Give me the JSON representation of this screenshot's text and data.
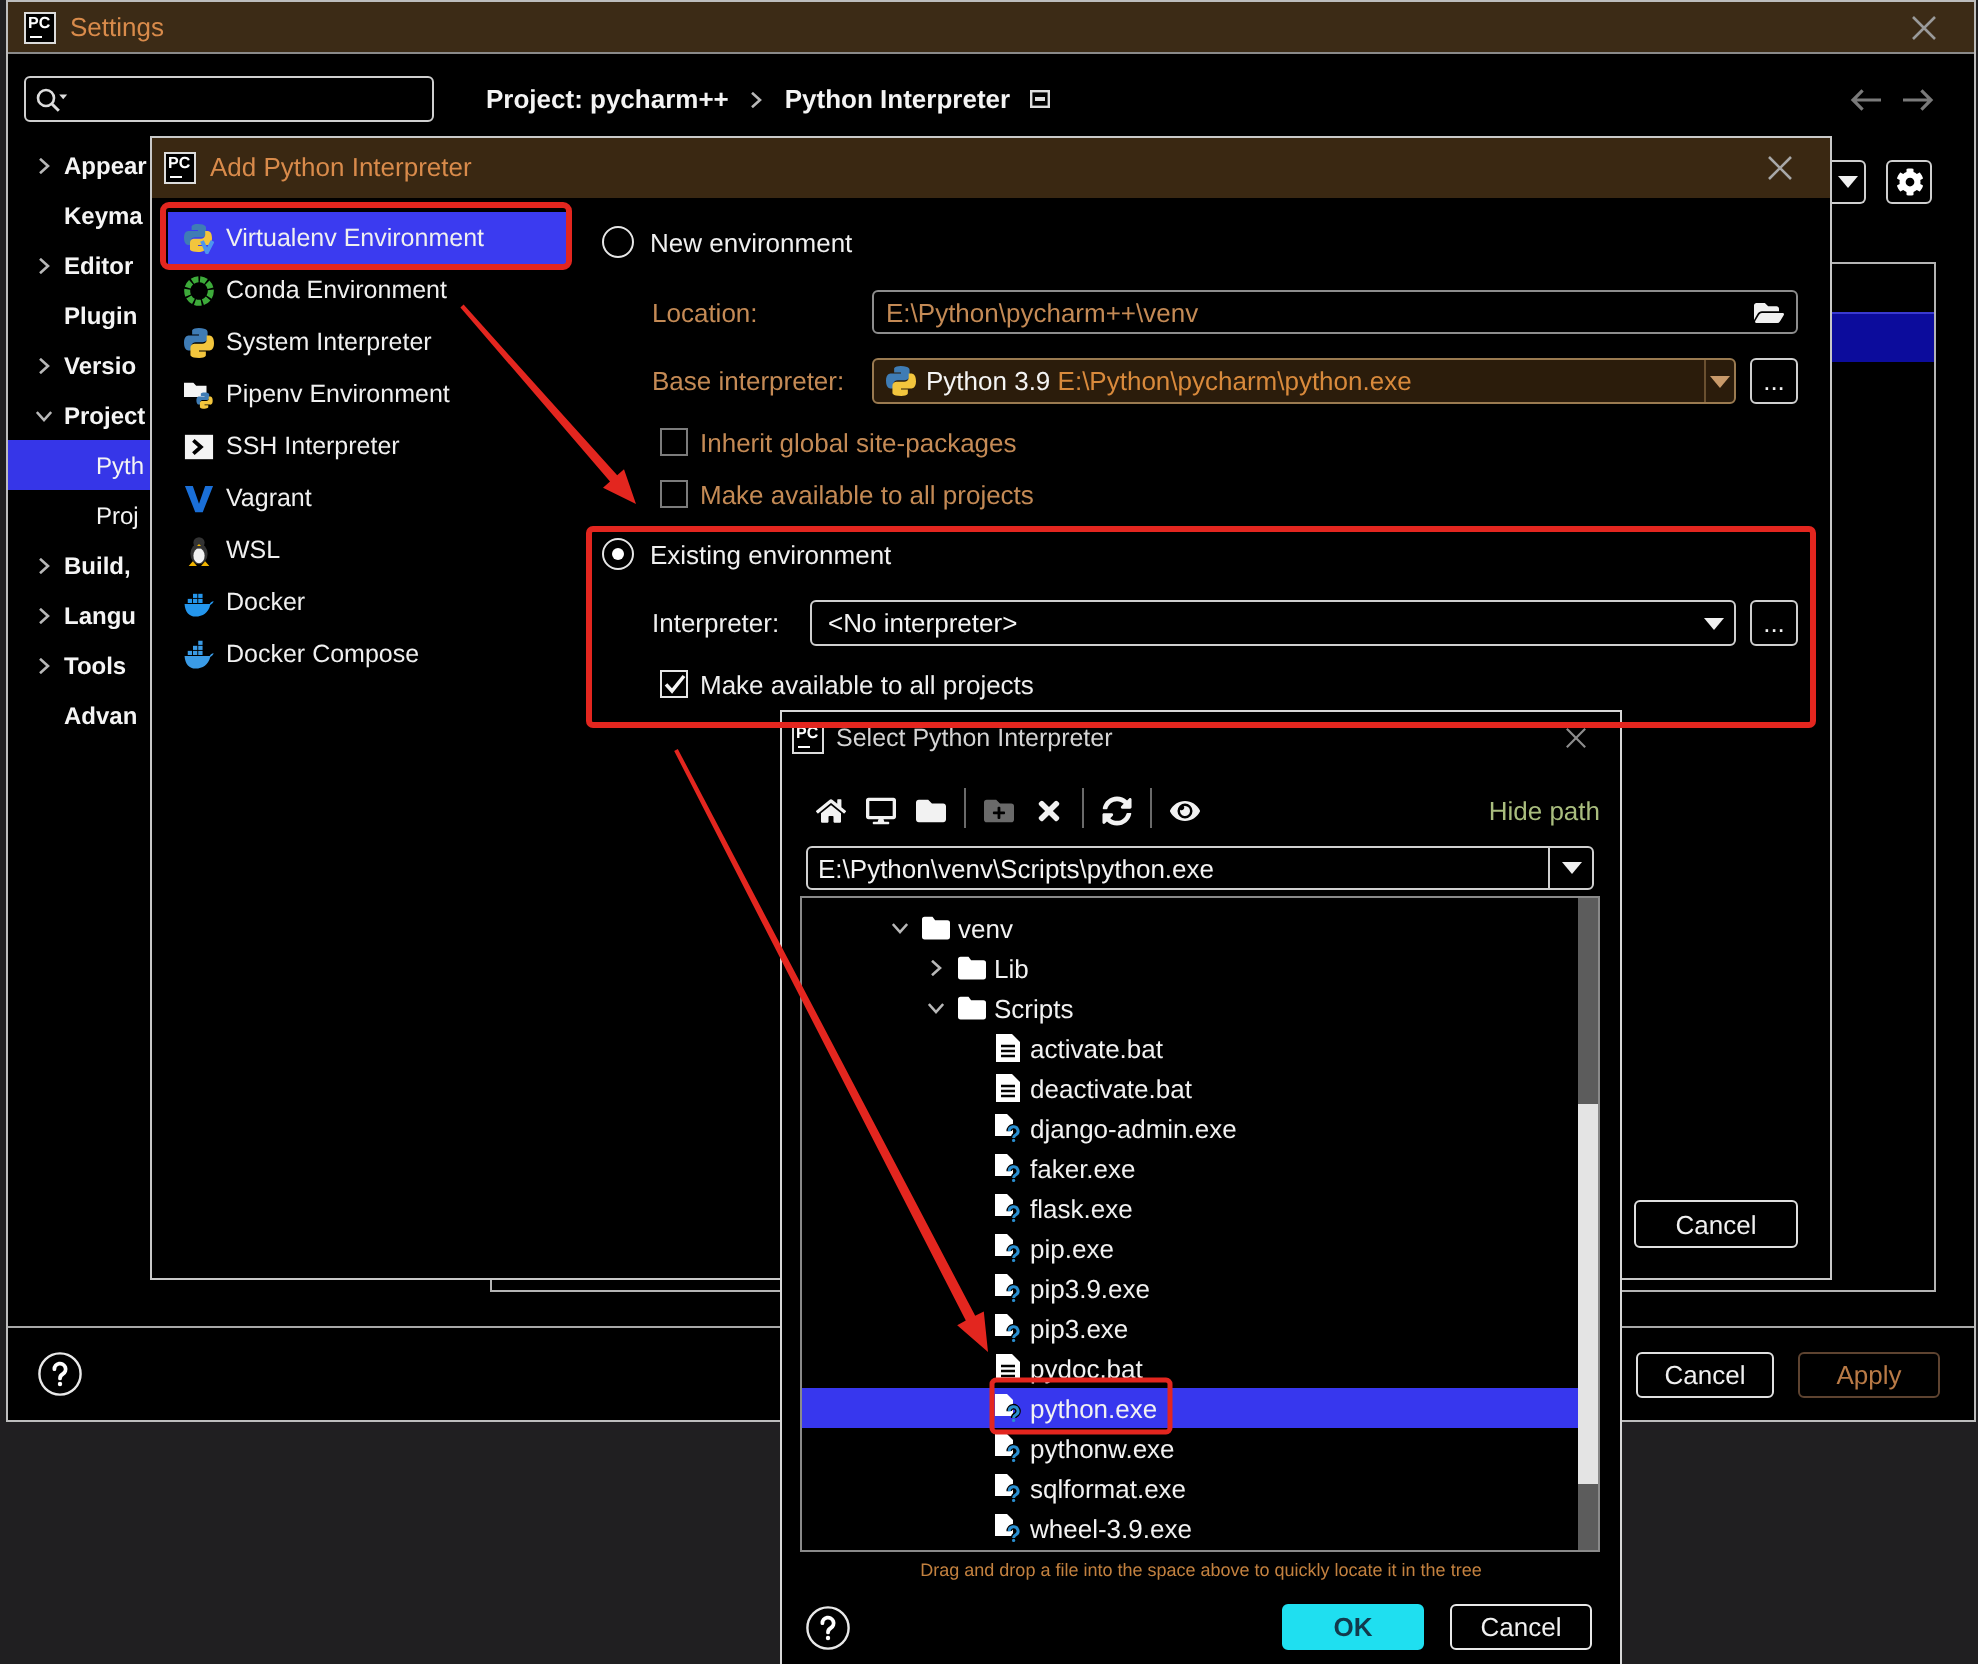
{
  "settings": {
    "logo": "PC",
    "title": "Settings",
    "breadcrumb": [
      "Project: pycharm++",
      "Python Interpreter"
    ],
    "nav": [
      {
        "kind": "back",
        "disabled": true
      },
      {
        "kind": "forward",
        "disabled": true
      }
    ],
    "sidebar": {
      "items": [
        {
          "label": "Appear",
          "expanded": false,
          "selected": false
        },
        {
          "label": "Keyma",
          "selected": false
        },
        {
          "label": "Editor",
          "expanded": false,
          "selected": false
        },
        {
          "label": "Plugin",
          "selected": false
        },
        {
          "label": "Versio",
          "expanded": false,
          "selected": false
        },
        {
          "label": "Project",
          "expanded": true,
          "selected": false,
          "children": [
            {
              "label": "Pyth",
              "selected": true
            },
            {
              "label": "Proj",
              "selected": false
            }
          ]
        },
        {
          "label": "Build,",
          "expanded": false,
          "selected": false
        },
        {
          "label": "Langu",
          "expanded": false,
          "selected": false
        },
        {
          "label": "Tools",
          "expanded": false,
          "selected": false
        },
        {
          "label": "Advan",
          "selected": false
        }
      ]
    },
    "packages_table": {
      "rows": [
        {
          "selected": true
        }
      ]
    },
    "buttons": [
      {
        "label": "Cancel",
        "disabled": false
      },
      {
        "label": "Apply",
        "disabled": true
      }
    ]
  },
  "add_interpreter": {
    "logo": "PC",
    "title": "Add Python Interpreter",
    "types": [
      {
        "label": "Virtualenv Environment",
        "kind": "virtualenv",
        "selected": true
      },
      {
        "label": "Conda Environment",
        "kind": "conda",
        "selected": false
      },
      {
        "label": "System Interpreter",
        "kind": "python",
        "selected": false
      },
      {
        "label": "Pipenv Environment",
        "kind": "pipenv",
        "selected": false
      },
      {
        "label": "SSH Interpreter",
        "kind": "ssh",
        "selected": false
      },
      {
        "label": "Vagrant",
        "kind": "vagrant",
        "selected": false
      },
      {
        "label": "WSL",
        "kind": "linux",
        "selected": false
      },
      {
        "label": "Docker",
        "kind": "docker",
        "selected": false
      },
      {
        "label": "Docker Compose",
        "kind": "compose",
        "selected": false
      }
    ],
    "new_environment": {
      "label": "New environment",
      "selected": false,
      "location": {
        "label": "Location:",
        "value": "E:\\Python\\pycharm++\\venv"
      },
      "base_interpreter": {
        "label": "Base interpreter:",
        "name": "Python 3.9",
        "path": "E:\\Python\\pycharm\\python.exe",
        "browse": "..."
      },
      "options": [
        {
          "label": "Inherit global site-packages",
          "checked": false
        },
        {
          "label": "Make available to all projects",
          "checked": false
        }
      ]
    },
    "existing_environment": {
      "label": "Existing environment",
      "selected": true,
      "interpreter": {
        "label": "Interpreter:",
        "value": "<No interpreter>",
        "browse": "..."
      },
      "options": [
        {
          "label": "Make available to all projects",
          "checked": true
        }
      ]
    },
    "buttons": [
      "Cancel"
    ]
  },
  "select_interpreter": {
    "logo": "PC",
    "title": "Select Python Interpreter",
    "toolbar": [
      {
        "kind": "home",
        "disabled": false
      },
      {
        "kind": "desktop",
        "disabled": false
      },
      {
        "kind": "project",
        "disabled": false
      },
      {
        "kind": "separator"
      },
      {
        "kind": "newfolder",
        "disabled": true
      },
      {
        "kind": "delete",
        "disabled": false
      },
      {
        "kind": "separator"
      },
      {
        "kind": "refresh",
        "disabled": false
      },
      {
        "kind": "separator"
      },
      {
        "kind": "hidden",
        "disabled": false
      }
    ],
    "hide_path": "Hide path",
    "path": "E:\\Python\\venv\\Scripts\\python.exe",
    "tree": [
      {
        "name": "venv",
        "kind": "folder",
        "expanded": true,
        "selected": false,
        "children": [
          {
            "name": "Lib",
            "kind": "folder",
            "expanded": false,
            "selected": false
          },
          {
            "name": "Scripts",
            "kind": "folder",
            "expanded": true,
            "selected": false,
            "children": [
              {
                "name": "activate.bat",
                "kind": "script",
                "selected": false
              },
              {
                "name": "deactivate.bat",
                "kind": "script",
                "selected": false
              },
              {
                "name": "django-admin.exe",
                "kind": "executable",
                "selected": false
              },
              {
                "name": "faker.exe",
                "kind": "executable",
                "selected": false
              },
              {
                "name": "flask.exe",
                "kind": "executable",
                "selected": false
              },
              {
                "name": "pip.exe",
                "kind": "executable",
                "selected": false
              },
              {
                "name": "pip3.9.exe",
                "kind": "executable",
                "selected": false
              },
              {
                "name": "pip3.exe",
                "kind": "executable",
                "selected": false
              },
              {
                "name": "pydoc.bat",
                "kind": "script",
                "selected": false
              },
              {
                "name": "python.exe",
                "kind": "executable",
                "selected": true
              },
              {
                "name": "pythonw.exe",
                "kind": "executable",
                "selected": false
              },
              {
                "name": "sqlformat.exe",
                "kind": "executable",
                "selected": false
              },
              {
                "name": "wheel-3.9.exe",
                "kind": "executable",
                "selected": false
              }
            ]
          }
        ]
      }
    ],
    "hint": "Drag and drop a file into the space above to quickly locate it in the tree",
    "buttons": [
      {
        "label": "OK",
        "default": true
      },
      {
        "label": "Cancel",
        "default": false
      }
    ]
  }
}
